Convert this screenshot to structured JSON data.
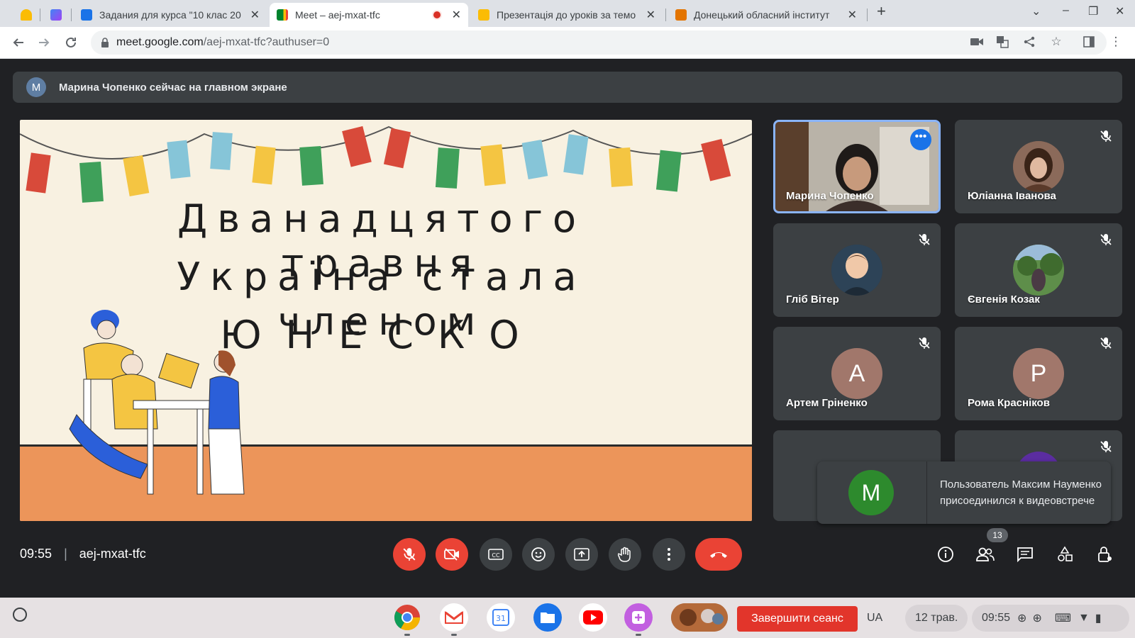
{
  "browser": {
    "tabs": [
      {
        "title": "",
        "favicon_color": "#fbbc04"
      },
      {
        "title": "",
        "favicon_color": "#7b61ff"
      },
      {
        "title": "Задания для курса \"10 клас 20",
        "favicon_color": "#1a73e8"
      },
      {
        "title": "Meet – aej-mxat-tfc",
        "favicon_color": "#00832d",
        "recording": true
      },
      {
        "title": "Презентація до уроків за темо",
        "favicon_color": "#fbbc04"
      },
      {
        "title": "Донецький обласний інститут",
        "favicon_color": "#e37400"
      }
    ],
    "url_host": "meet.google.com",
    "url_path": "/aej-mxat-tfc?authuser=0"
  },
  "meet": {
    "banner_avatar": "M",
    "banner_text": "Марина Чопенко сейчас на главном экране",
    "slide": {
      "line1": "Дванадцятого травня",
      "line2": "Україна стала членом",
      "line3": "ЮНЕСКО"
    },
    "participants": [
      {
        "name": "Марина Чопенко",
        "kind": "video",
        "muted": false,
        "speaking": true
      },
      {
        "name": "Юліанна Іванова",
        "kind": "photo",
        "muted": true
      },
      {
        "name": "Гліб Вітер",
        "kind": "photo",
        "muted": true
      },
      {
        "name": "Євгенія Козак",
        "kind": "photo",
        "muted": true
      },
      {
        "name": "Артем Гріненко",
        "kind": "letter",
        "letter": "А",
        "color": "#a1776b",
        "muted": true
      },
      {
        "name": "Рома Красніков",
        "kind": "letter",
        "letter": "Р",
        "color": "#a1776b",
        "muted": true
      },
      {
        "name": "",
        "kind": "group",
        "muted": false
      },
      {
        "name": "",
        "kind": "photo",
        "muted": true
      }
    ],
    "toast": {
      "avatar_letter": "M",
      "text": "Пользователь Максим Науменко присоединился к видеовстрече"
    },
    "time": "09:55",
    "meeting_code": "aej-mxat-tfc",
    "people_count": "13"
  },
  "shelf": {
    "end_session": "Завершити сеанс",
    "keyboard": "UA",
    "date": "12 трав.",
    "clock": "09:55"
  }
}
